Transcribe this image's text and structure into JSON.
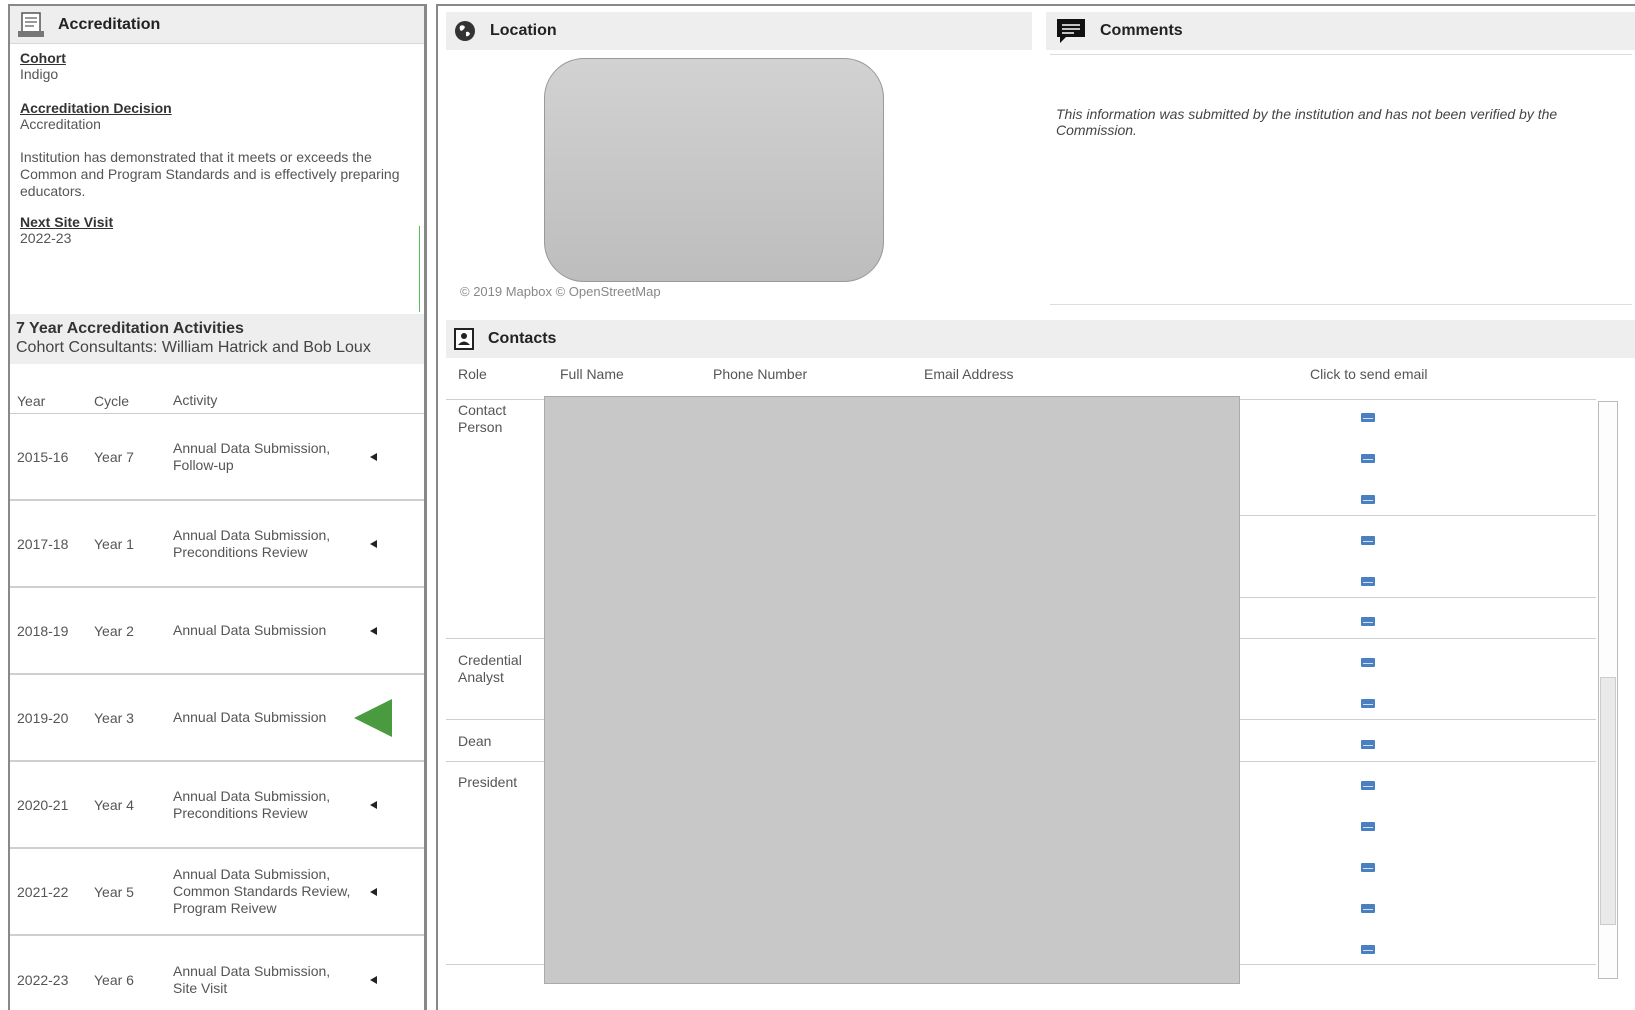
{
  "accreditation": {
    "title": "Accreditation",
    "cohort_label": "Cohort",
    "cohort_value": "Indigo",
    "decision_label": "Accreditation Decision",
    "decision_value": "Accreditation",
    "description": "Institution has demonstrated that it meets or exceeds the Common and Program Standards and is effectively preparing educators.",
    "next_visit_label": "Next Site Visit",
    "next_visit_value": "2022-23"
  },
  "activities": {
    "title": "7 Year Accreditation Activities",
    "subtitle": "Cohort Consultants: William Hatrick and Bob Loux",
    "headers": {
      "year": "Year",
      "cycle": "Cycle",
      "activity": "Activity"
    },
    "rows": [
      {
        "year": "2015-16",
        "cycle": "Year 7",
        "activity": "Annual Data Submission, Follow-up"
      },
      {
        "year": "2017-18",
        "cycle": "Year 1",
        "activity": "Annual Data Submission, Preconditions Review"
      },
      {
        "year": "2018-19",
        "cycle": "Year 2",
        "activity": "Annual Data Submission"
      },
      {
        "year": "2019-20",
        "cycle": "Year 3",
        "activity": "Annual Data Submission",
        "current": true
      },
      {
        "year": "2020-21",
        "cycle": "Year 4",
        "activity": "Annual Data Submission, Preconditions Review"
      },
      {
        "year": "2021-22",
        "cycle": "Year 5",
        "activity": "Annual Data Submission, Common Standards Review, Program Reivew"
      },
      {
        "year": "2022-23",
        "cycle": "Year 6",
        "activity": "Annual Data Submission, Site Visit"
      }
    ]
  },
  "location": {
    "title": "Location",
    "map_credit": "© 2019 Mapbox © OpenStreetMap"
  },
  "comments": {
    "title": "Comments",
    "text": "This information was submitted by the institution and has not been verified by the Commission."
  },
  "contacts": {
    "title": "Contacts",
    "headers": {
      "role": "Role",
      "full_name": "Full Name",
      "phone": "Phone Number",
      "email": "Email Address",
      "send": "Click to send email"
    },
    "roles": [
      "Contact Person",
      "Credential Analyst",
      "Dean",
      "President"
    ],
    "email_icon_count": 14,
    "colors": {
      "email_icon": "#4a7fc0",
      "current_arrow": "#4a9a40"
    }
  }
}
